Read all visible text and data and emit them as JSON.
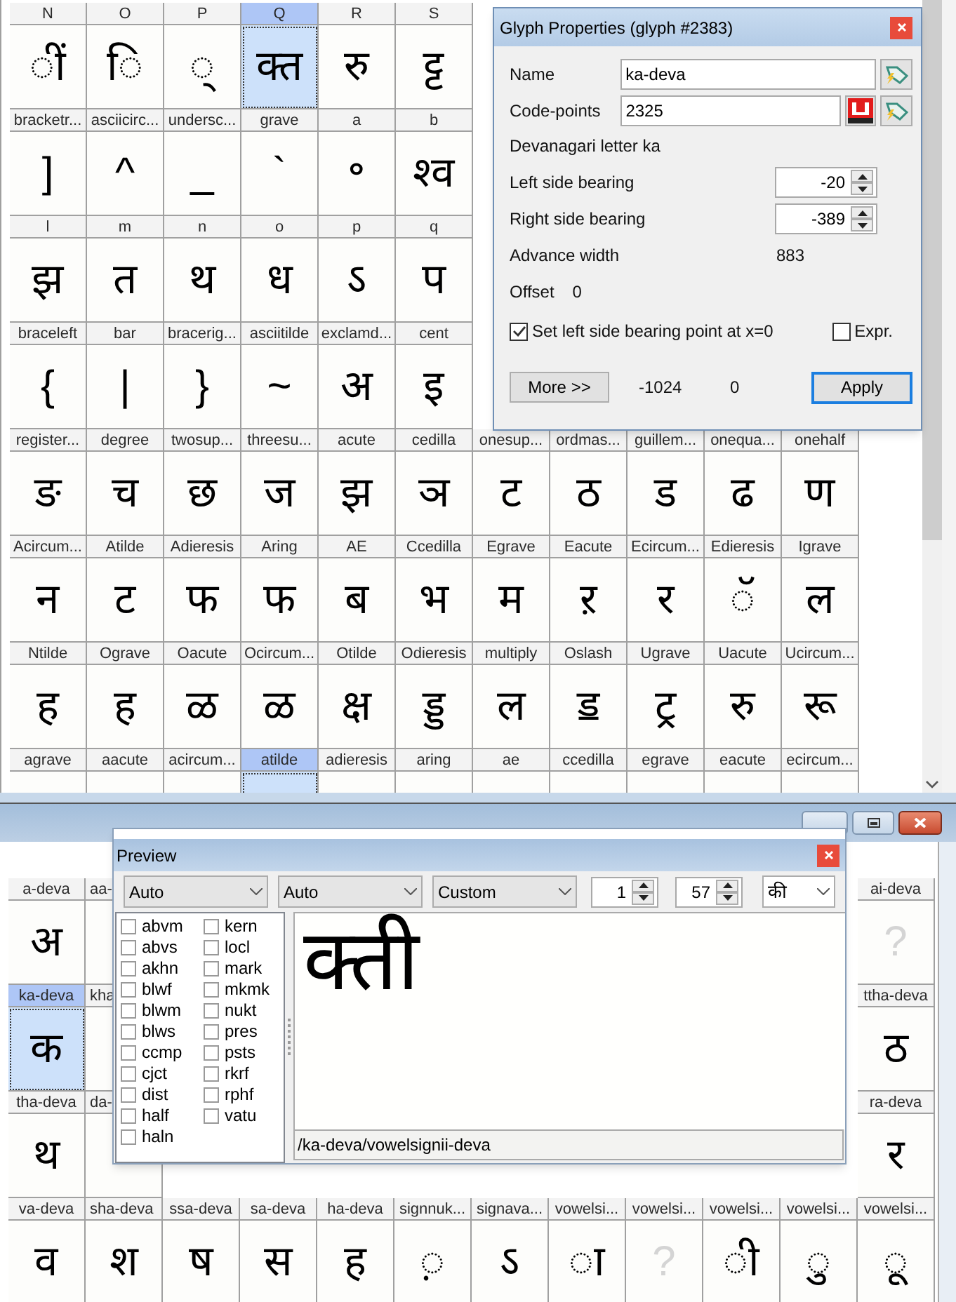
{
  "glyph_grid": {
    "rows": [
      {
        "cells": [
          {
            "label": "N",
            "glyph": "ीं",
            "selected": false
          },
          {
            "label": "O",
            "glyph": "ि",
            "selected": false
          },
          {
            "label": "P",
            "glyph": "्",
            "selected": false
          },
          {
            "label": "Q",
            "glyph": "क्त",
            "selected": true
          },
          {
            "label": "R",
            "glyph": "रु",
            "selected": false
          },
          {
            "label": "S",
            "glyph": "ट्ट",
            "selected": false
          },
          null,
          null,
          null,
          null,
          null
        ]
      },
      {
        "cells": [
          {
            "label": "bracketr...",
            "glyph": "]",
            "selected": false
          },
          {
            "label": "asciicirc...",
            "glyph": "^",
            "selected": false
          },
          {
            "label": "undersc...",
            "glyph": "_",
            "selected": false
          },
          {
            "label": "grave",
            "glyph": "`",
            "selected": false
          },
          {
            "label": "a",
            "glyph": "॰",
            "selected": false
          },
          {
            "label": "b",
            "glyph": "श्व",
            "selected": false
          },
          null,
          null,
          null,
          null,
          null
        ]
      },
      {
        "cells": [
          {
            "label": "l",
            "glyph": "झ",
            "selected": false
          },
          {
            "label": "m",
            "glyph": "त",
            "selected": false
          },
          {
            "label": "n",
            "glyph": "थ",
            "selected": false
          },
          {
            "label": "o",
            "glyph": "ध",
            "selected": false
          },
          {
            "label": "p",
            "glyph": "ऽ",
            "selected": false
          },
          {
            "label": "q",
            "glyph": "प",
            "selected": false
          },
          null,
          null,
          null,
          null,
          null
        ]
      },
      {
        "cells": [
          {
            "label": "braceleft",
            "glyph": "{",
            "selected": false
          },
          {
            "label": "bar",
            "glyph": "|",
            "selected": false
          },
          {
            "label": "bracerig...",
            "glyph": "}",
            "selected": false
          },
          {
            "label": "asciitilde",
            "glyph": "~",
            "selected": false
          },
          {
            "label": "exclamd...",
            "glyph": "अ",
            "selected": false
          },
          {
            "label": "cent",
            "glyph": "इ",
            "selected": false
          },
          null,
          null,
          null,
          null,
          null
        ]
      },
      {
        "cells": [
          {
            "label": "register...",
            "glyph": "ङ",
            "selected": false
          },
          {
            "label": "degree",
            "glyph": "च",
            "selected": false
          },
          {
            "label": "twosup...",
            "glyph": "छ",
            "selected": false
          },
          {
            "label": "threesu...",
            "glyph": "ज",
            "selected": false
          },
          {
            "label": "acute",
            "glyph": "झ",
            "selected": false
          },
          {
            "label": "cedilla",
            "glyph": "ञ",
            "selected": false
          },
          {
            "label": "onesup...",
            "glyph": "ट",
            "selected": false
          },
          {
            "label": "ordmas...",
            "glyph": "ठ",
            "selected": false
          },
          {
            "label": "guillem...",
            "glyph": "ड",
            "selected": false
          },
          {
            "label": "onequa...",
            "glyph": "ढ",
            "selected": false
          },
          {
            "label": "onehalf",
            "glyph": "ण",
            "selected": false
          }
        ]
      },
      {
        "cells": [
          {
            "label": "Acircum...",
            "glyph": "न",
            "selected": false
          },
          {
            "label": "Atilde",
            "glyph": "ट",
            "selected": false
          },
          {
            "label": "Adieresis",
            "glyph": "फ",
            "selected": false
          },
          {
            "label": "Aring",
            "glyph": "फ",
            "selected": false
          },
          {
            "label": "AE",
            "glyph": "ब",
            "selected": false
          },
          {
            "label": "Ccedilla",
            "glyph": "भ",
            "selected": false
          },
          {
            "label": "Egrave",
            "glyph": "म",
            "selected": false
          },
          {
            "label": "Eacute",
            "glyph": "ऱ",
            "selected": false
          },
          {
            "label": "Ecircum...",
            "glyph": "र",
            "selected": false
          },
          {
            "label": "Edieresis",
            "glyph": "ॅ",
            "selected": false
          },
          {
            "label": "Igrave",
            "glyph": "ल",
            "selected": false
          }
        ]
      },
      {
        "cells": [
          {
            "label": "Ntilde",
            "glyph": "ह",
            "selected": false
          },
          {
            "label": "Ograve",
            "glyph": "ह",
            "selected": false
          },
          {
            "label": "Oacute",
            "glyph": "ळ",
            "selected": false
          },
          {
            "label": "Ocircum...",
            "glyph": "ळ",
            "selected": false
          },
          {
            "label": "Otilde",
            "glyph": "क्ष",
            "selected": false
          },
          {
            "label": "Odieresis",
            "glyph": "ड्ड",
            "selected": false
          },
          {
            "label": "multiply",
            "glyph": "ल",
            "selected": false
          },
          {
            "label": "Oslash",
            "glyph": "ॾ",
            "selected": false
          },
          {
            "label": "Ugrave",
            "glyph": "ट्र",
            "selected": false
          },
          {
            "label": "Uacute",
            "glyph": "रु",
            "selected": false
          },
          {
            "label": "Ucircum...",
            "glyph": "रू",
            "selected": false
          }
        ]
      },
      {
        "cells": [
          {
            "label": "agrave",
            "selected": false
          },
          {
            "label": "aacute",
            "selected": false
          },
          {
            "label": "acircum...",
            "selected": false
          },
          {
            "label": "atilde",
            "selected": true
          },
          {
            "label": "adieresis",
            "selected": false
          },
          {
            "label": "aring",
            "selected": false
          },
          {
            "label": "ae",
            "selected": false
          },
          {
            "label": "ccedilla",
            "selected": false
          },
          {
            "label": "egrave",
            "selected": false
          },
          {
            "label": "eacute",
            "selected": false
          },
          {
            "label": "ecircum...",
            "selected": false
          }
        ]
      }
    ]
  },
  "glyph_properties": {
    "title": "Glyph Properties (glyph #2383)",
    "name": {
      "label": "Name",
      "value": "ka-deva"
    },
    "code_points": {
      "label": "Code-points",
      "value": "2325"
    },
    "description": "Devanagari letter ka",
    "left_side_bearing": {
      "label": "Left side bearing",
      "value": "-20"
    },
    "right_side_bearing": {
      "label": "Right side bearing",
      "value": "-389"
    },
    "advance_width": {
      "label": "Advance width",
      "value": "883"
    },
    "offset": {
      "label": "Offset",
      "value": "0"
    },
    "set_lsb": {
      "label": "Set left side bearing point at x=0",
      "checked": true
    },
    "expr": {
      "label": "Expr.",
      "checked": false
    },
    "more_button": "More >>",
    "readout_1": "-1024",
    "readout_2": "0",
    "apply_button": "Apply"
  },
  "font_window": {
    "grid": {
      "rows": [
        {
          "cells": [
            {
              "label": "a-deva",
              "glyph": "अ",
              "missing": false,
              "selected": false
            },
            {
              "label": "aa-",
              "selected": false
            },
            null,
            null,
            null,
            null,
            null,
            null,
            null,
            null,
            null,
            {
              "label": "ai-deva",
              "glyph": "?",
              "missing": true,
              "selected": false
            }
          ]
        },
        {
          "cells": [
            {
              "label": "ka-deva",
              "glyph": "क",
              "missing": false,
              "selected": true
            },
            {
              "label": "kha",
              "selected": false
            },
            null,
            null,
            null,
            null,
            null,
            null,
            null,
            null,
            null,
            {
              "label": "ttha-deva",
              "glyph": "ठ",
              "missing": false,
              "selected": false
            }
          ]
        },
        {
          "cells": [
            {
              "label": "tha-deva",
              "glyph": "थ",
              "missing": false,
              "selected": false
            },
            {
              "label": "da-",
              "selected": false
            },
            null,
            null,
            null,
            null,
            null,
            null,
            null,
            null,
            null,
            {
              "label": "ra-deva",
              "glyph": "र",
              "missing": false,
              "selected": false
            }
          ]
        },
        {
          "cells": [
            {
              "label": "va-deva",
              "glyph": "व",
              "missing": false,
              "selected": false
            },
            {
              "label": "sha-deva",
              "glyph": "श",
              "missing": false,
              "selected": false
            },
            {
              "label": "ssa-deva",
              "glyph": "ष",
              "missing": false,
              "selected": false
            },
            {
              "label": "sa-deva",
              "glyph": "स",
              "missing": false,
              "selected": false
            },
            {
              "label": "ha-deva",
              "glyph": "ह",
              "missing": false,
              "selected": false
            },
            {
              "label": "signnuk...",
              "glyph": "़",
              "missing": false,
              "selected": false
            },
            {
              "label": "signava...",
              "glyph": "ऽ",
              "missing": false,
              "selected": false
            },
            {
              "label": "vowelsi...",
              "glyph": "ा",
              "missing": false,
              "selected": false
            },
            {
              "label": "vowelsi...",
              "glyph": "?",
              "missing": true,
              "selected": false
            },
            {
              "label": "vowelsi...",
              "glyph": "ी",
              "missing": false,
              "selected": false
            },
            {
              "label": "vowelsi...",
              "glyph": "ु",
              "missing": false,
              "selected": false
            },
            {
              "label": "vowelsi...",
              "glyph": "ू",
              "missing": false,
              "selected": false
            }
          ]
        }
      ]
    }
  },
  "preview": {
    "title": "Preview",
    "dropdowns": [
      {
        "value": "Auto"
      },
      {
        "value": "Auto"
      },
      {
        "value": "Custom"
      }
    ],
    "spinboxes": [
      {
        "value": "1"
      },
      {
        "value": "57"
      }
    ],
    "text_dropdown": "की",
    "features": [
      {
        "tag": "abvm",
        "checked": false
      },
      {
        "tag": "abvs",
        "checked": false
      },
      {
        "tag": "akhn",
        "checked": false
      },
      {
        "tag": "blwf",
        "checked": false
      },
      {
        "tag": "blwm",
        "checked": false
      },
      {
        "tag": "blws",
        "checked": false
      },
      {
        "tag": "ccmp",
        "checked": false
      },
      {
        "tag": "cjct",
        "checked": false
      },
      {
        "tag": "dist",
        "checked": false
      },
      {
        "tag": "half",
        "checked": false
      },
      {
        "tag": "haln",
        "checked": false
      },
      {
        "tag": "kern",
        "checked": false
      },
      {
        "tag": "locl",
        "checked": false
      },
      {
        "tag": "mark",
        "checked": false
      },
      {
        "tag": "mkmk",
        "checked": false
      },
      {
        "tag": "nukt",
        "checked": false
      },
      {
        "tag": "pres",
        "checked": false
      },
      {
        "tag": "psts",
        "checked": false
      },
      {
        "tag": "rkrf",
        "checked": false
      },
      {
        "tag": "rphf",
        "checked": false
      },
      {
        "tag": "vatu",
        "checked": false
      }
    ],
    "rendered_text": "क्ती",
    "glyph_path": "/ka-deva/vowelsignii-deva"
  }
}
